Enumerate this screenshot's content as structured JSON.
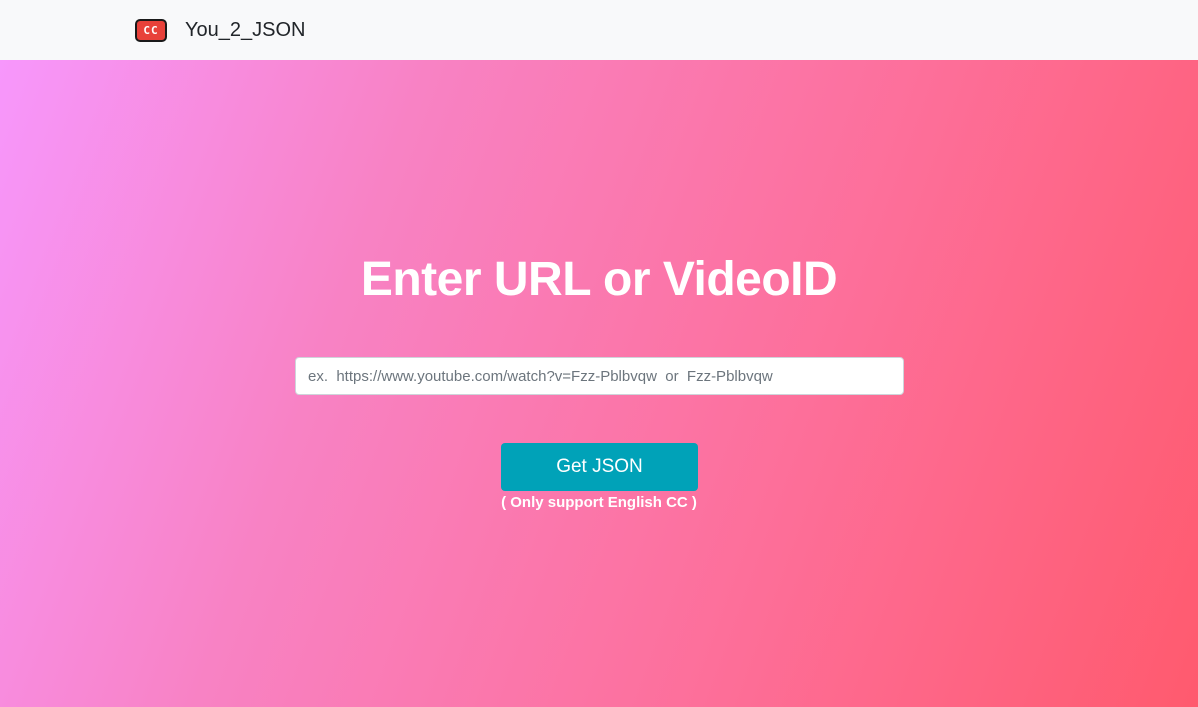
{
  "navbar": {
    "logo_text": "CC",
    "logo_icon": "closed-caption-icon",
    "brand_name": "You_2_JSON"
  },
  "hero": {
    "title": "Enter URL or VideoID",
    "input": {
      "value": "",
      "placeholder": "ex.  https://www.youtube.com/watch?v=Fzz-Pblbvqw  or  Fzz-Pblbvqw"
    },
    "button_label": "Get JSON",
    "note": "( Only support English CC )"
  },
  "colors": {
    "navbar_bg": "#f8f9fa",
    "gradient_start": "#f797fc",
    "gradient_end": "#ff5a6e",
    "button_bg": "#00a2b8",
    "logo_red": "#e8413a"
  }
}
